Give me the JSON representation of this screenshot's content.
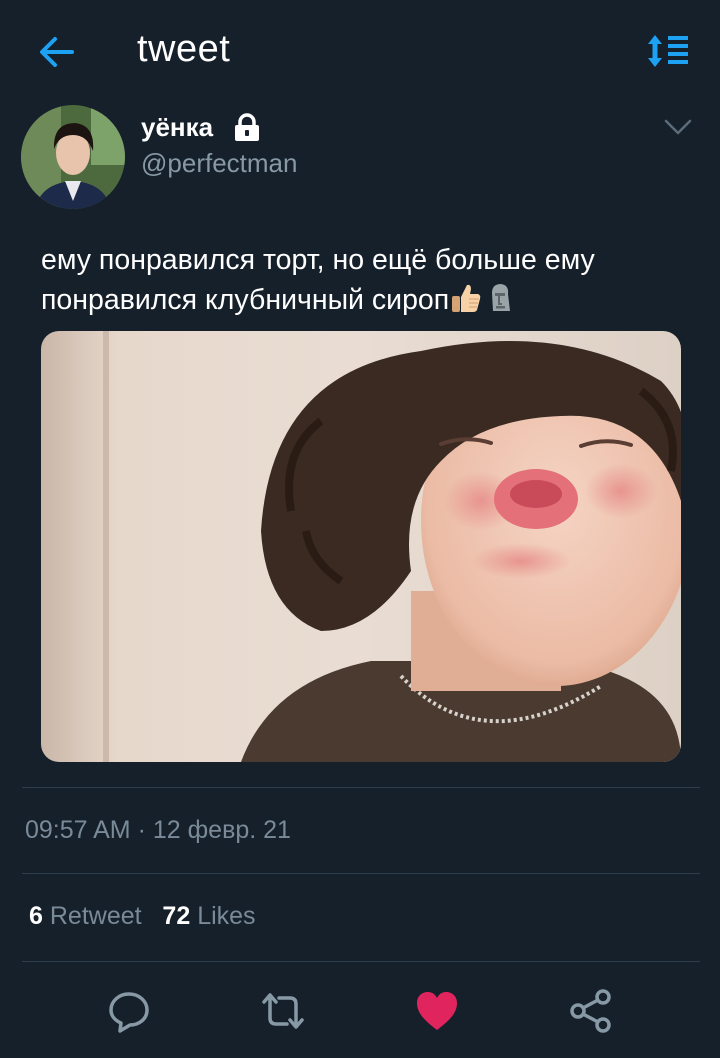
{
  "header": {
    "title": "tweet",
    "back_icon": "arrow-left-icon",
    "sort_icon": "sort-icon"
  },
  "author": {
    "display_name": "уёнка",
    "handle": "@perfectman",
    "protected_icon": "lock-icon"
  },
  "tweet": {
    "text_line1": "ему понравился торт, но ещё больше ему",
    "text_line2": "понравился клубничный сироп",
    "emojis": [
      "thumbs-up",
      "moai"
    ],
    "timestamp": "09:57 AM · 12 февр. 21"
  },
  "stats": {
    "retweets_count": "6",
    "retweets_label": "Retweet",
    "likes_count": "72",
    "likes_label": "Likes"
  },
  "actions": [
    "reply-icon",
    "retweet-icon",
    "like-icon",
    "share-icon"
  ],
  "colors": {
    "background": "#15202b",
    "accent": "#1da1f2",
    "muted": "#8899a6",
    "like": "#e0245e",
    "divider": "#2e3d4b"
  }
}
